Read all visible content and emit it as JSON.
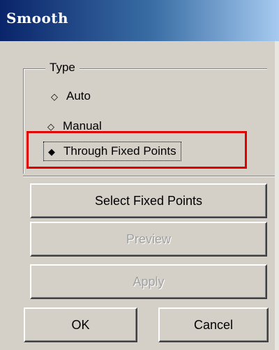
{
  "window": {
    "title": "Smooth"
  },
  "type_group": {
    "label": "Type",
    "options": [
      {
        "label": "Auto",
        "mark": "◇"
      },
      {
        "label": "Manual",
        "mark": "◇"
      },
      {
        "label": "Through Fixed Points",
        "mark": "◆",
        "selected": true
      }
    ]
  },
  "buttons": {
    "select_fixed_points": "Select Fixed Points",
    "preview": "Preview",
    "apply": "Apply",
    "ok": "OK",
    "cancel": "Cancel"
  },
  "annotation": {
    "highlight_color": "#e00000"
  }
}
